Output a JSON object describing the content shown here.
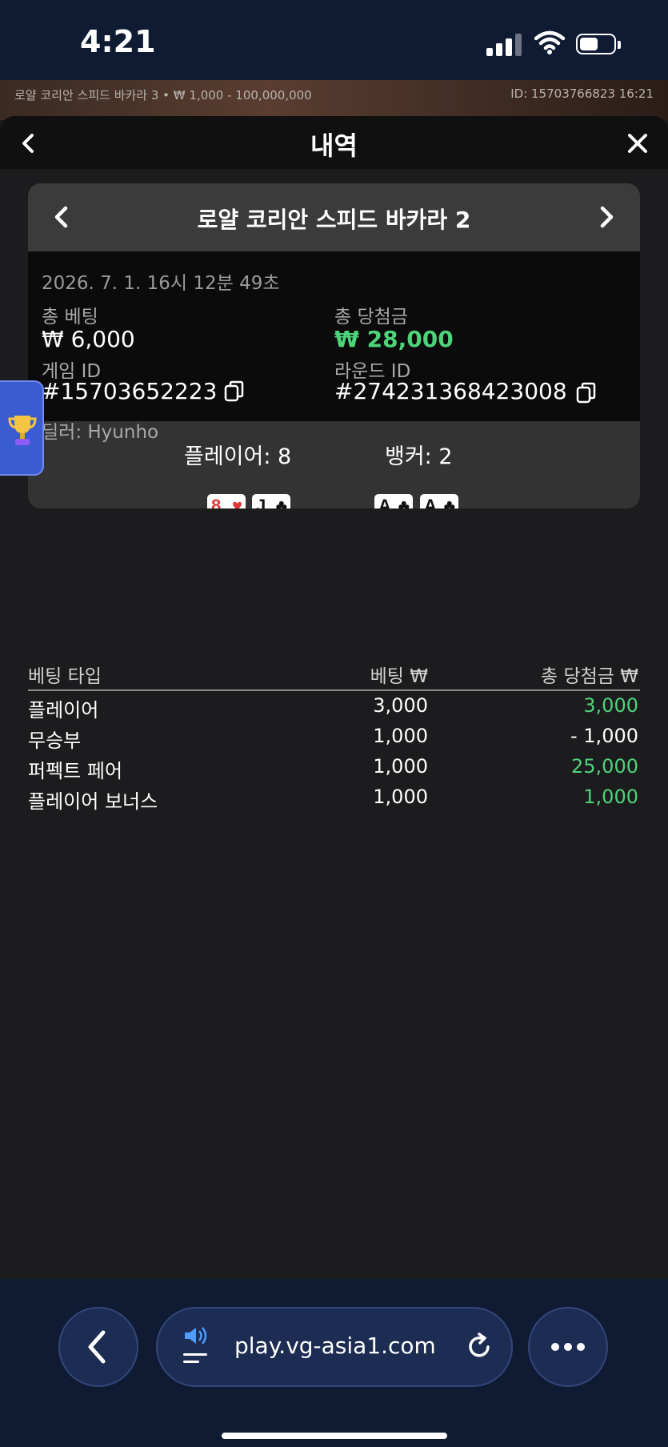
{
  "status_bar": {
    "time": "4:21"
  },
  "game_strip": {
    "left_text": "로얄 코리안 스피드 바카라 3 • ₩ 1,000 - 100,000,000",
    "right_text": "ID: 15703766823 16:21"
  },
  "header": {
    "title": "내역"
  },
  "round": {
    "game_name": "로얄 코리안 스피드 바카라 2",
    "datetime": "2026. 7. 1. 16시 12분 49초",
    "total_bet_label": "총 베팅",
    "total_bet_value": "₩ 6,000",
    "total_win_label": "총 당첨금",
    "total_win_value": "₩ 28,000",
    "game_id_label": "게임 ID",
    "game_id_value": "#15703652223",
    "round_id_label": "라운드 ID",
    "round_id_value": "#274231368423008",
    "dealer": "딜러: Hyunho"
  },
  "hands": {
    "player_label": "플레이어: 8",
    "banker_label": "뱅커: 2",
    "player_cards": [
      {
        "rank": "8",
        "suit": "♥",
        "color": "#e03535"
      },
      {
        "rank": "J",
        "suit": "♣",
        "color": "#111111"
      }
    ],
    "banker_cards": [
      {
        "rank": "A",
        "suit": "♣",
        "color": "#111111"
      },
      {
        "rank": "A",
        "suit": "♣",
        "color": "#111111"
      }
    ]
  },
  "bets": {
    "headers": {
      "type": "베팅 타입",
      "bet": "베팅 ₩",
      "win": "총 당첨금 ₩"
    },
    "rows": [
      {
        "type": "플레이어",
        "bet": "3,000",
        "win": "3,000",
        "positive": true
      },
      {
        "type": "무승부",
        "bet": "1,000",
        "win": "- 1,000",
        "positive": false
      },
      {
        "type": "퍼펙트 페어",
        "bet": "1,000",
        "win": "25,000",
        "positive": true
      },
      {
        "type": "플레이어 보너스",
        "bet": "1,000",
        "win": "1,000",
        "positive": true
      }
    ]
  },
  "browser": {
    "url": "play.vg-asia1.com"
  },
  "colors": {
    "win_green": "#4fd37a",
    "browser_bg": "#0f1a33",
    "trophy_tab": "#3b5bd0"
  }
}
